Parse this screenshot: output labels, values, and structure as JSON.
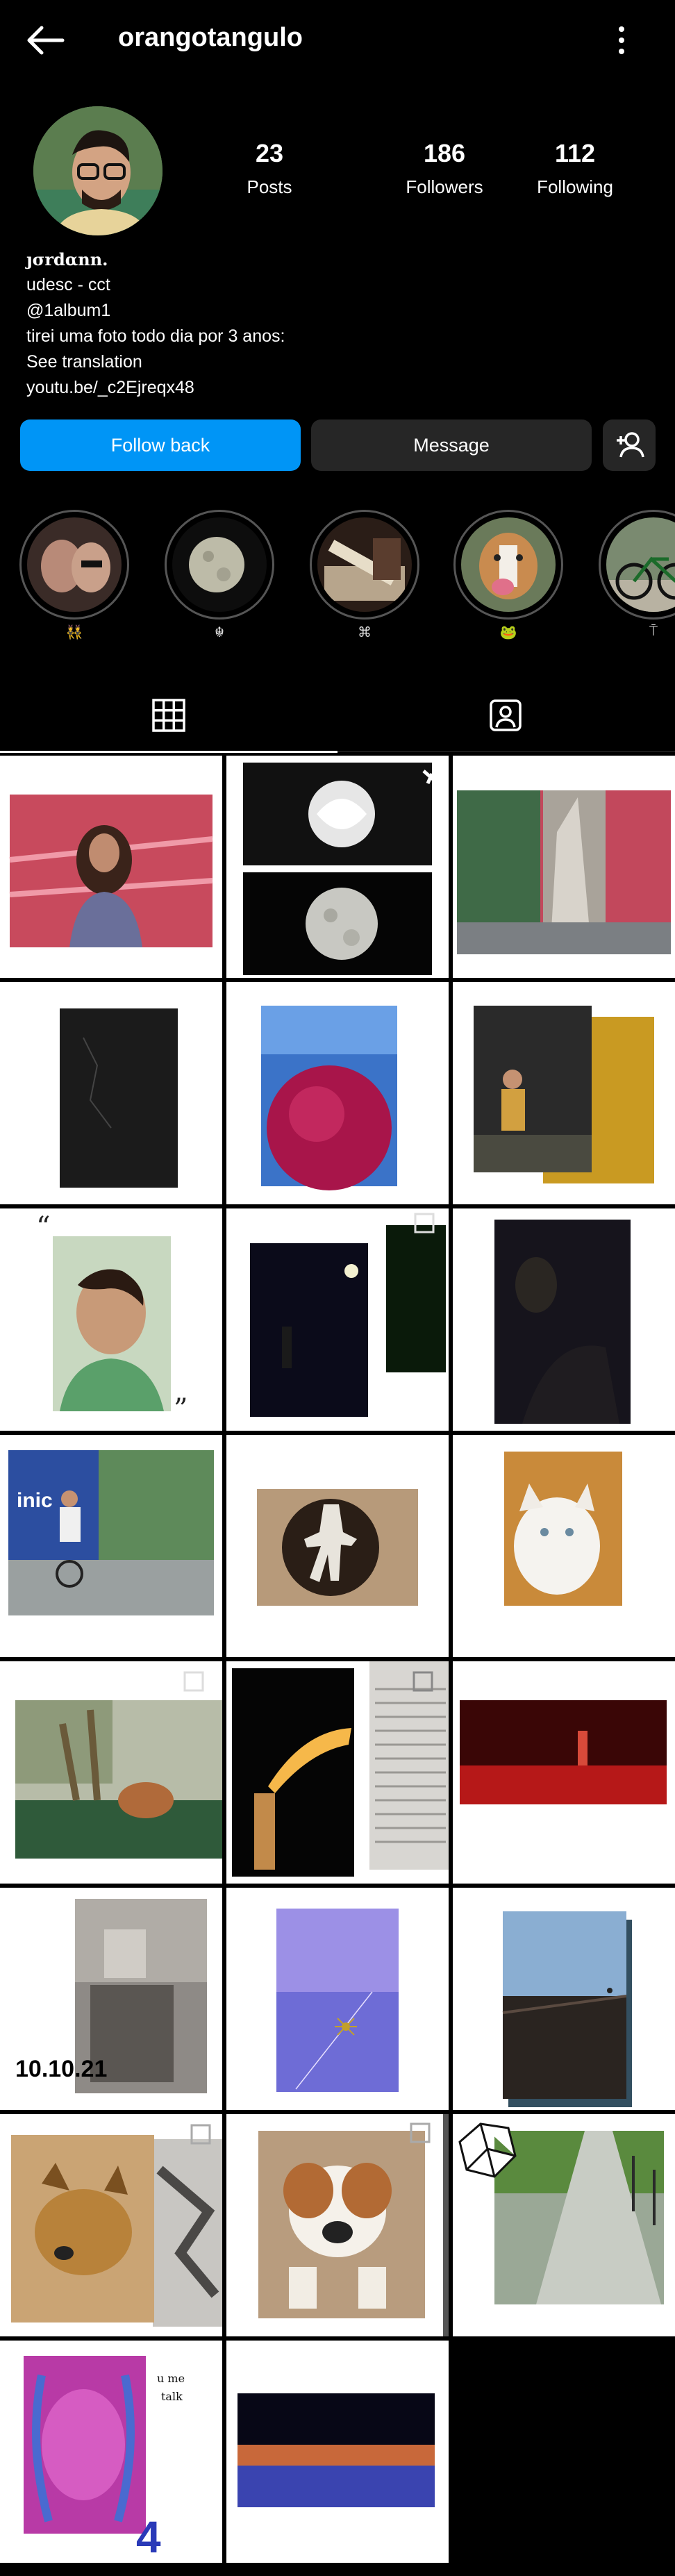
{
  "header": {
    "username": "orangotangulo"
  },
  "profile": {
    "stats": [
      {
        "value": "23",
        "label": "Posts"
      },
      {
        "value": "186",
        "label": "Followers"
      },
      {
        "value": "112",
        "label": "Following"
      }
    ],
    "display_name": "ȷσrdαnn.",
    "bio_lines": [
      "udesc - cct",
      "@1album1",
      "tirei uma foto todo dia por 3 anos:",
      "See translation",
      "youtu.be/_c2Ejreqx48"
    ]
  },
  "actions": {
    "follow_back": "Follow back",
    "message": "Message"
  },
  "highlights": [
    {
      "label": "👯"
    },
    {
      "label": "☬"
    },
    {
      "label": "⌘"
    },
    {
      "label": "🐸"
    },
    {
      "label": "⍑"
    }
  ],
  "colors": {
    "accent": "#0095f6",
    "button_dark": "#262626",
    "background": "#000000"
  },
  "posts": [
    {
      "overlay": ""
    },
    {
      "overlay": ""
    },
    {
      "overlay": ""
    },
    {
      "overlay": ""
    },
    {
      "overlay": ""
    },
    {
      "overlay": ""
    },
    {
      "overlay": ""
    },
    {
      "overlay": ""
    },
    {
      "overlay": ""
    },
    {
      "overlay": ""
    },
    {
      "overlay": ""
    },
    {
      "overlay": ""
    },
    {
      "overlay": ""
    },
    {
      "overlay": ""
    },
    {
      "overlay": ""
    },
    {
      "overlay": "10.10.21"
    },
    {
      "overlay": ""
    },
    {
      "overlay": ""
    },
    {
      "overlay": ""
    },
    {
      "overlay": ""
    },
    {
      "overlay": ""
    },
    {
      "overlay": "4"
    },
    {
      "overlay": ""
    }
  ]
}
